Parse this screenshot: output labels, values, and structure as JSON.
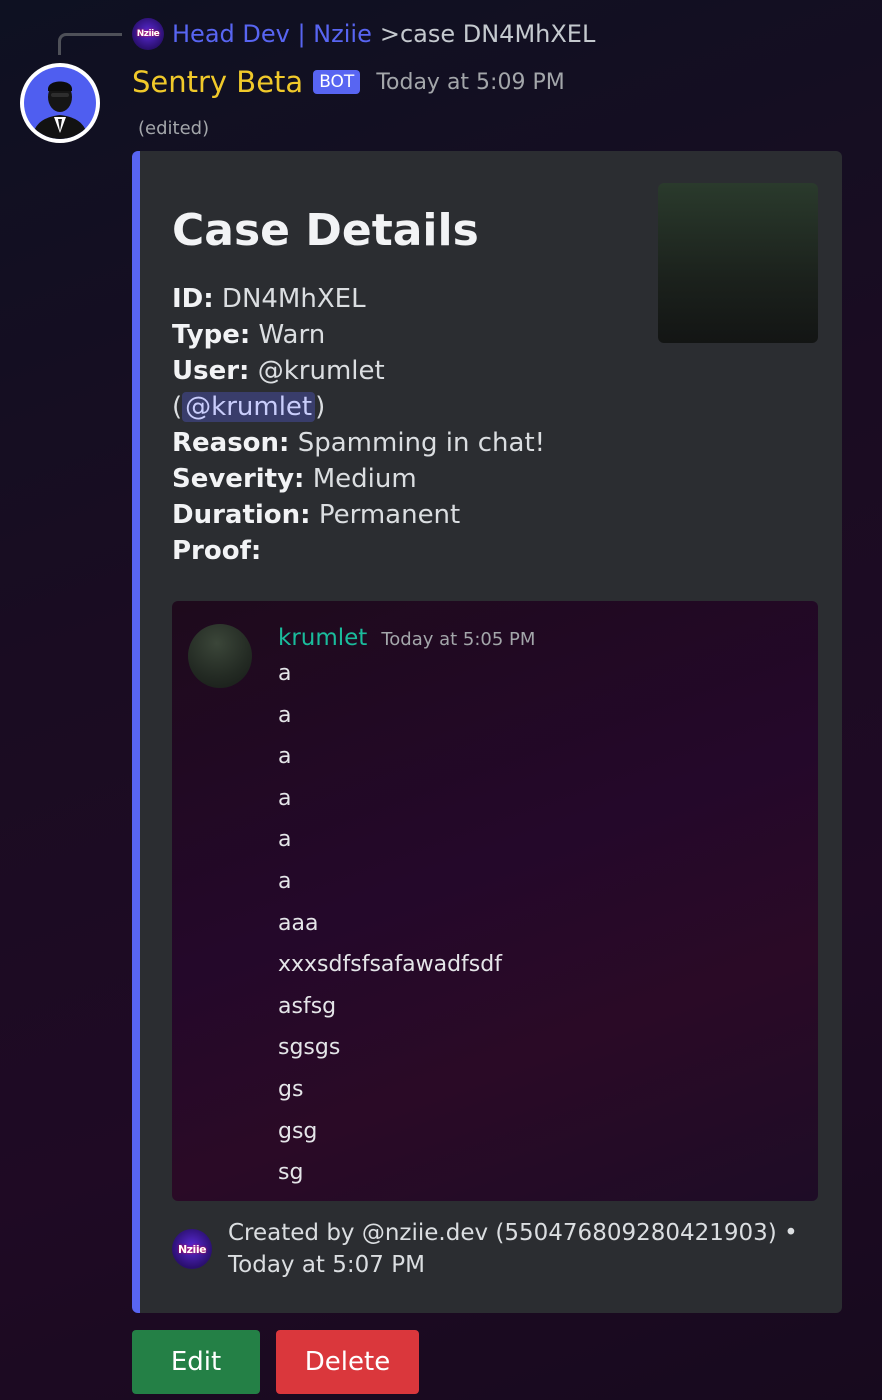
{
  "reply": {
    "author": "Head Dev | Nziie",
    "content": ">case DN4MhXEL",
    "avatar_icon": "nziie-logo-icon",
    "avatar_text": "Nziie"
  },
  "message": {
    "username": "Sentry Beta",
    "username_color": "#f0c92a",
    "bot_tag": "BOT",
    "timestamp": "Today at 5:09 PM",
    "edited": "(edited)",
    "avatar_icon": "suited-man-avatar-icon"
  },
  "embed": {
    "accent_color": "#5865f2",
    "title": "Case Details",
    "fields": {
      "id_label": "ID:",
      "id_value": "DN4MhXEL",
      "type_label": "Type:",
      "type_value": "Warn",
      "user_label": "User:",
      "user_value": "@krumlet",
      "user_paren_open": "(",
      "user_mention": "@krumlet",
      "user_paren_close": ")",
      "reason_label": "Reason:",
      "reason_value": "Spamming in chat!",
      "severity_label": "Severity:",
      "severity_value": "Medium",
      "duration_label": "Duration:",
      "duration_value": "Permanent",
      "proof_label": "Proof:"
    },
    "proof": {
      "username": "krumlet",
      "timestamp": "Today at 5:05 PM",
      "lines": [
        "a",
        "a",
        "a",
        "a",
        "a",
        "a",
        "aaa",
        "xxxsdfsfsafawadfsdf",
        "asfsg",
        "sgsgs",
        "gs",
        "gsg",
        "sg"
      ]
    },
    "footer": {
      "icon": "nziie-logo-icon",
      "icon_text": "Nziie",
      "text": "Created by @nziie.dev (550476809280421903) • Today at 5:07 PM"
    }
  },
  "buttons": {
    "edit": "Edit",
    "delete": "Delete"
  }
}
